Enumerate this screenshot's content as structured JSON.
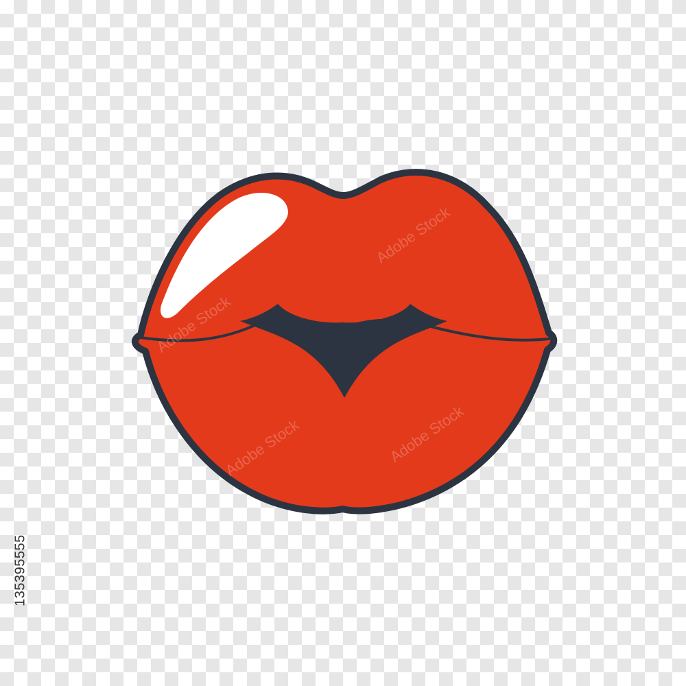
{
  "image": {
    "subject": "red-lips-kiss-icon",
    "colors": {
      "lip_fill": "#e33a1c",
      "outline": "#2b3440",
      "highlight": "#ffffff",
      "checker_light": "#ffffff",
      "checker_dark": "#e6e6e6"
    }
  },
  "watermark": {
    "text": "Adobe Stock"
  },
  "stock_id": "135395555"
}
